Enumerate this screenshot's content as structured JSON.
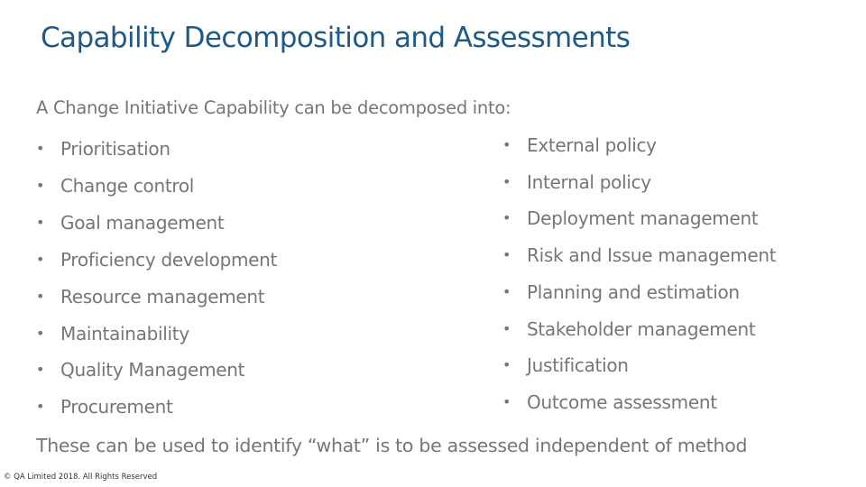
{
  "slide": {
    "title": "Capability Decomposition and Assessments",
    "intro": "A Change Initiative Capability can be decomposed into:",
    "bullet_glyph": "•",
    "left_column": [
      "Prioritisation",
      "Change control",
      "Goal management",
      "Proficiency development",
      "Resource management",
      "Maintainability",
      "Quality Management",
      "Procurement"
    ],
    "right_column": [
      "External policy",
      "Internal policy",
      "Deployment management",
      "Risk and Issue management",
      "Planning and estimation",
      "Stakeholder management",
      "Justification",
      "Outcome assessment"
    ],
    "closing": "These can be used to identify “what” is to be assessed independent of method",
    "footer": "© QA Limited 2018. All Rights Reserved"
  },
  "colors": {
    "title": "#1d5a8a",
    "body_text": "#767676"
  }
}
